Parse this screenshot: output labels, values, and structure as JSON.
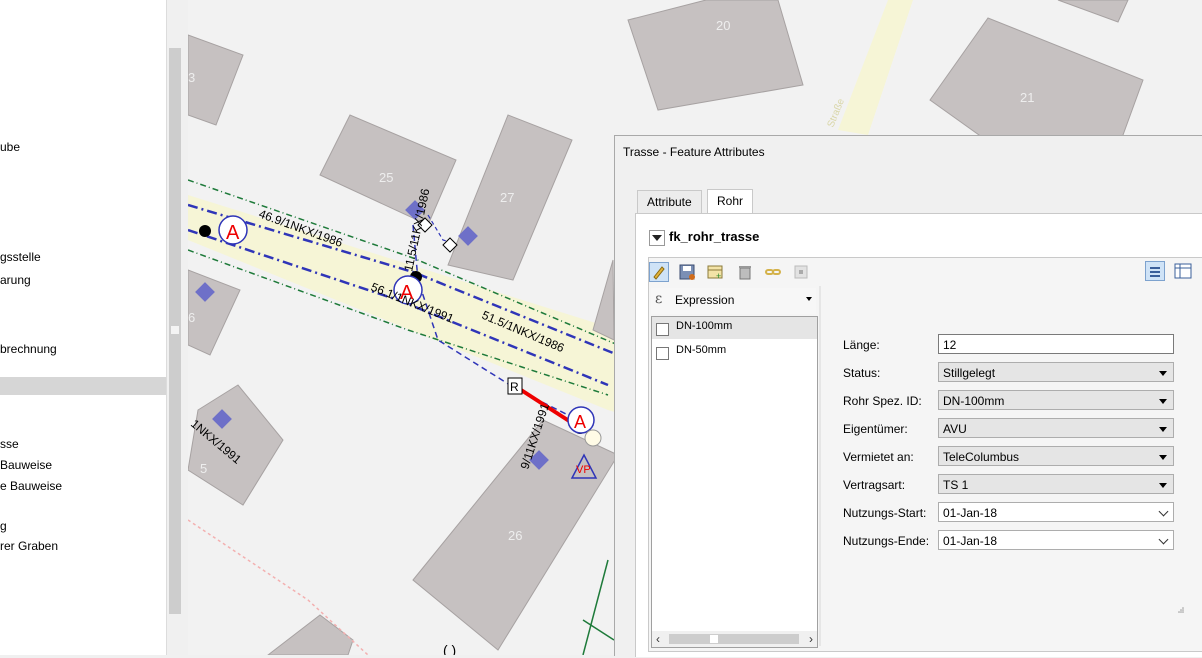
{
  "left_panel": {
    "items": [
      "ube",
      "gsstelle",
      "arung",
      "brechnung",
      "sse",
      "Bauweise",
      "e Bauweise",
      "g",
      "rer Graben"
    ]
  },
  "map": {
    "building_numbers": [
      "20",
      "3",
      "21",
      "25",
      "27",
      "26",
      "6",
      "5",
      "26"
    ],
    "line_labels": [
      "46.9/1NKX/1986",
      "11.5/11KX/1986",
      "56.1/1NKX/1991",
      "51.5/1NKX/1986",
      "9/11KX/1991",
      "1NKX/1991"
    ],
    "street_label": "Straße"
  },
  "dialog": {
    "title": "Trasse - Feature Attributes",
    "tabs": [
      "Attribute",
      "Rohr"
    ],
    "active_tab": "Rohr",
    "relation_title": "fk_rohr_trasse",
    "expression_label": "Expression",
    "list_items": [
      "DN-100mm",
      "DN-50mm"
    ],
    "fields": [
      {
        "label": "Länge:",
        "value": "12",
        "kind": "text"
      },
      {
        "label": "Status:",
        "value": "Stillgelegt",
        "kind": "combo"
      },
      {
        "label": "Rohr Spez. ID:",
        "value": "DN-100mm",
        "kind": "combo"
      },
      {
        "label": "Eigentümer:",
        "value": "AVU",
        "kind": "combo"
      },
      {
        "label": "Vermietet an:",
        "value": "TeleColumbus",
        "kind": "combo"
      },
      {
        "label": "Vertragsart:",
        "value": "TS 1",
        "kind": "combo"
      },
      {
        "label": "Nutzungs-Start:",
        "value": "01-Jan-18",
        "kind": "date"
      },
      {
        "label": "Nutzungs-Ende:",
        "value": "01-Jan-18",
        "kind": "date"
      }
    ]
  },
  "colors": {
    "building": "#c6c1c1",
    "road": "#f6f5d6",
    "pipe_blue": "#2f35b8",
    "pipe_green": "#1e7a3a",
    "highlight_red": "#ee0000",
    "selection": "#cfe3f7"
  }
}
